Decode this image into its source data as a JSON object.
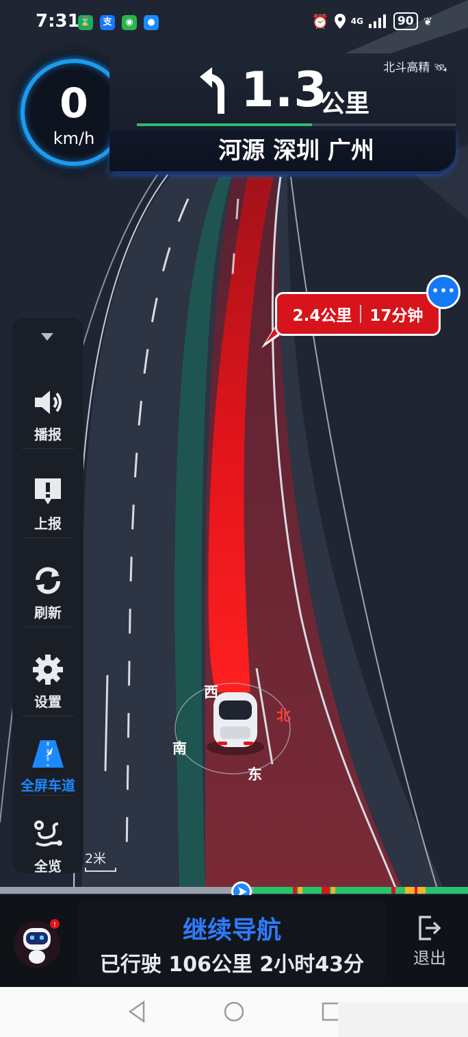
{
  "status_bar": {
    "time": "7:31",
    "apps": [
      {
        "icon": "hourglass-app-icon",
        "glyph": "⌛",
        "color": "#1aad5a"
      },
      {
        "icon": "alipay-app-icon",
        "glyph": "支",
        "color": "#1677ff"
      },
      {
        "icon": "wechat-app-icon",
        "glyph": "◉",
        "color": "#2ab54a"
      },
      {
        "icon": "message-app-icon",
        "glyph": "●",
        "color": "#1a8cff"
      }
    ],
    "signal": "4G",
    "battery": "90"
  },
  "speed": {
    "value": "0",
    "unit": "km/h"
  },
  "guidance": {
    "source_label": "北斗高精",
    "distance": "1.3",
    "distance_unit": "公里",
    "progress": 0.55,
    "road_names": "河源 深圳 广州"
  },
  "route_bubble": {
    "distance": "2.4公里",
    "time": "17分钟"
  },
  "sidebar": {
    "items": [
      {
        "label": "播报",
        "icon": "speaker-icon"
      },
      {
        "label": "上报",
        "icon": "report-icon"
      },
      {
        "label": "刷新",
        "icon": "refresh-icon"
      },
      {
        "label": "设置",
        "icon": "gear-icon"
      },
      {
        "label": "全屏车道",
        "icon": "lane-view-icon"
      },
      {
        "label": "全览",
        "icon": "overview-route-icon"
      }
    ]
  },
  "scale": "2米",
  "compass": {
    "west": "西",
    "north": "北",
    "south": "南",
    "east": "东"
  },
  "bottom": {
    "title": "继续导航",
    "traveled": "已行驶 106公里 2小时43分",
    "exit_label": "退出"
  },
  "colors": {
    "accent": "#1d9bf0",
    "route_red": "#e0141b",
    "traffic_green": "#27c46d"
  }
}
